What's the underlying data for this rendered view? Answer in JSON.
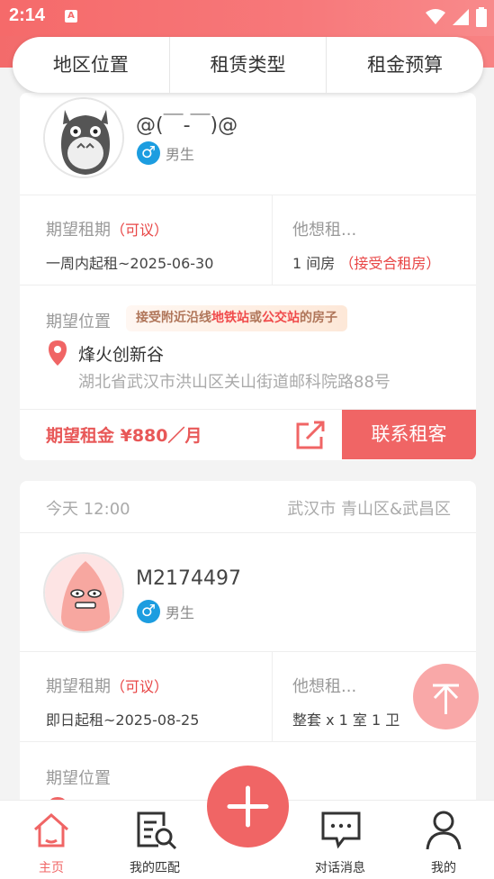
{
  "status_bar": {
    "time": "2:14",
    "app_indicator": "A",
    "icons": [
      "wifi-icon",
      "signal-icon",
      "battery-icon"
    ]
  },
  "filter_bar": {
    "tabs": [
      "地区位置",
      "租赁类型",
      "租金预算"
    ]
  },
  "listing1": {
    "username": "@(￣-￣)@",
    "gender": "男生",
    "period_label": "期望租期",
    "period_tag": "（可议）",
    "period_value": "一周内起租~2025-06-30",
    "wants_label": "他想租...",
    "wants_value": "1 间房",
    "wants_tag": "（接受合租房）",
    "location_label": "期望位置",
    "badge": {
      "p1": "接受附近沿线",
      "hl1": "地铁站",
      "p2": "或",
      "hl2": "公交站",
      "p3": "的房子"
    },
    "location_name": "烽火创新谷",
    "location_address": "湖北省武汉市洪山区关山街道邮科院路88号",
    "price": "期望租金 ¥880／月",
    "contact_button": "联系租客"
  },
  "listing2": {
    "time": "今天 12:00",
    "area": "武汉市 青山区&武昌区",
    "username": "M2174497",
    "gender": "男生",
    "period_label": "期望租期",
    "period_tag": "（可议）",
    "period_value": "即日起租~2025-08-25",
    "wants_label": "他想租...",
    "wants_value": "整套 x 1 室 1 卫",
    "location_label": "期望位置"
  },
  "tab_bar": {
    "items": [
      "主页",
      "我的匹配",
      "对话消息",
      "我的"
    ]
  },
  "colors": {
    "brand": "#f06565",
    "gender_blue": "#1c9de0"
  }
}
